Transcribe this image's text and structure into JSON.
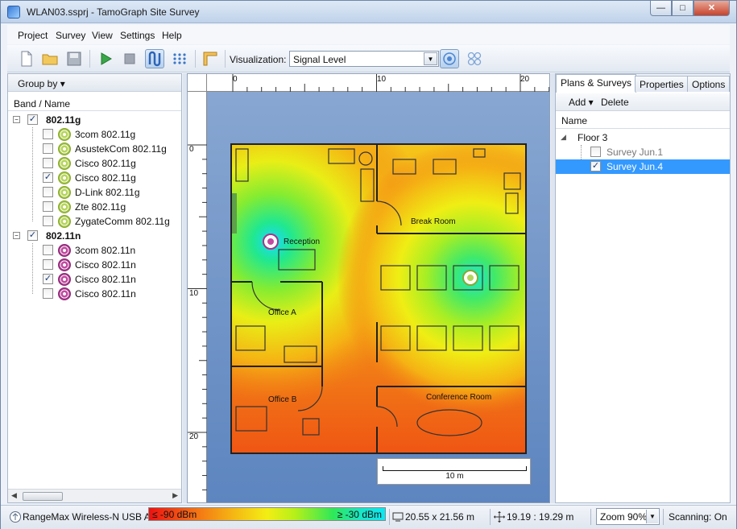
{
  "window": {
    "title": "WLAN03.ssprj  -  TamoGraph Site Survey",
    "min_glyph": "—",
    "max_glyph": "□",
    "close_glyph": "✕"
  },
  "menu": [
    "Project",
    "Survey",
    "View",
    "Settings",
    "Help"
  ],
  "toolbar": {
    "visualization_label": "Visualization:",
    "visualization_value": "Signal Level"
  },
  "left_panel": {
    "group_by": "Group by ▾",
    "column": "Band / Name",
    "groups": [
      {
        "name": "802.11g",
        "checked": true,
        "items": [
          {
            "name": "3com 802.11g",
            "checked": false
          },
          {
            "name": "AsustekCom 802.11g",
            "checked": false
          },
          {
            "name": "Cisco 802.11g",
            "checked": false
          },
          {
            "name": "Cisco 802.11g",
            "checked": true
          },
          {
            "name": "D-Link 802.11g",
            "checked": false
          },
          {
            "name": "Zte 802.11g",
            "checked": false
          },
          {
            "name": "ZygateComm 802.11g",
            "checked": false
          }
        ]
      },
      {
        "name": "802.11n",
        "checked": true,
        "items": [
          {
            "name": "3com 802.11n",
            "checked": false
          },
          {
            "name": "Cisco 802.11n",
            "checked": false
          },
          {
            "name": "Cisco 802.11n",
            "checked": true
          },
          {
            "name": "Cisco 802.11n",
            "checked": false
          }
        ]
      }
    ]
  },
  "map": {
    "ruler_top": [
      "0",
      "10",
      "20"
    ],
    "ruler_left": [
      "0",
      "10",
      "20"
    ],
    "rooms": {
      "reception": "Reception",
      "break_room": "Break Room",
      "office_a": "Office A",
      "office_b": "Office B",
      "conference": "Conference Room"
    },
    "scale": "10 m"
  },
  "right_panel": {
    "tabs": [
      "Plans & Surveys",
      "Properties",
      "Options"
    ],
    "add": "Add ▾",
    "delete": "Delete",
    "column": "Name",
    "floor": "Floor 3",
    "surveys": [
      {
        "name": "Survey Jun.1",
        "checked": false,
        "selected": false
      },
      {
        "name": "Survey Jun.4",
        "checked": true,
        "selected": true
      }
    ]
  },
  "status": {
    "adapter": "RangeMax Wireless-N USB A",
    "legend_low": "≤ -90 dBm",
    "legend_high": "≥ -30 dBm",
    "dimensions": "20.55 x 21.56 m",
    "cursor": "19.19 : 19.29 m",
    "zoom": "Zoom 90%",
    "scanning": "Scanning: On"
  },
  "colors": {
    "selection": "#3399ff",
    "signal_strong": "#18e6c8",
    "signal_weak": "#ee1111"
  }
}
